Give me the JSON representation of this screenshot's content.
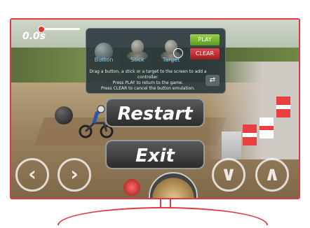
{
  "hud": {
    "time": "0.0s"
  },
  "controller": {
    "items": [
      {
        "label": "Button"
      },
      {
        "label": "Stick"
      },
      {
        "label": "Target"
      }
    ],
    "play_label": "PLAY",
    "clear_label": "CLEAR",
    "help_lines": [
      "Drag a button, a stick or a target to the screen to add a controller.",
      "Press PLAY to return to the game.",
      "Press CLEAR to cancel the button emulation."
    ]
  },
  "menu": {
    "restart_label": "Restart",
    "exit_label": "Exit"
  },
  "controls": {
    "left_glyph": "‹",
    "right_glyph": "›",
    "down_glyph": "∨",
    "up_glyph": "∧"
  },
  "colors": {
    "monitor_frame": "#e03a42",
    "play_button": "#7bbf2e",
    "clear_button": "#d02f31",
    "label_blue": "#7cc8f0"
  }
}
